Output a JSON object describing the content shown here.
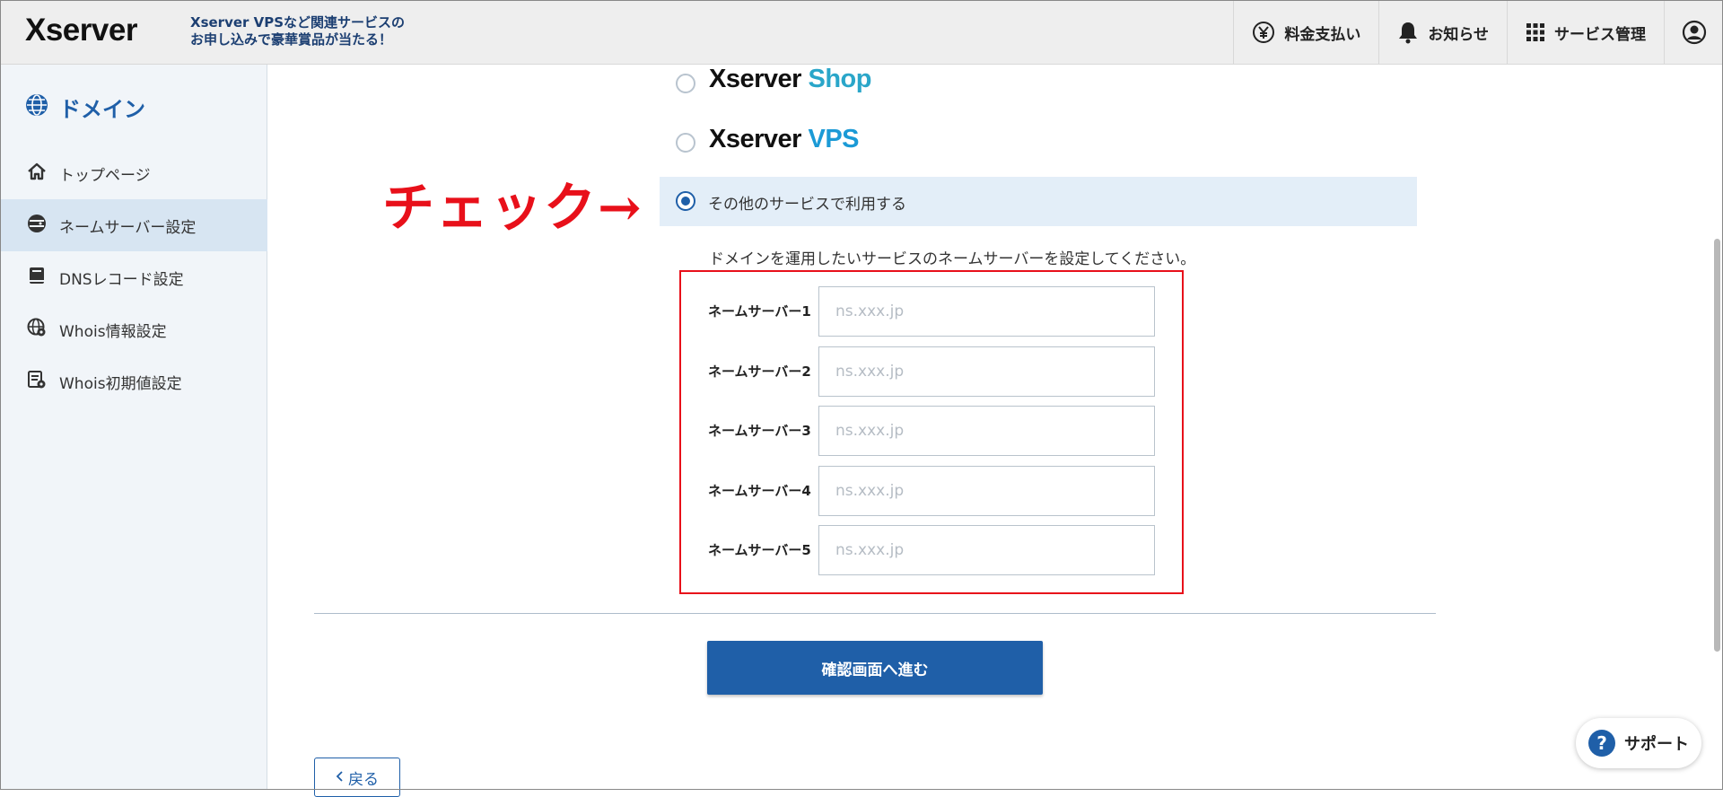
{
  "header": {
    "logo": "Xserver",
    "promo_line1": "Xserver VPSなど関連サービスの",
    "promo_line2": "お申し込みで豪華賞品が当たる！",
    "nav": {
      "payment": "料金支払い",
      "notice": "お知らせ",
      "service": "サービス管理"
    }
  },
  "sidebar": {
    "title": "ドメイン",
    "items": [
      {
        "label": "トップページ",
        "icon": "home-icon"
      },
      {
        "label": "ネームサーバー設定",
        "icon": "server-icon"
      },
      {
        "label": "DNSレコード設定",
        "icon": "book-icon"
      },
      {
        "label": "Whois情報設定",
        "icon": "globe-gear-icon"
      },
      {
        "label": "Whois初期値設定",
        "icon": "document-gear-icon"
      }
    ]
  },
  "main": {
    "options": {
      "shop": {
        "prefix": "Xserver",
        "suffix": "Shop"
      },
      "vps": {
        "prefix": "Xserver",
        "suffix": "VPS"
      },
      "other": "その他のサービスで利用する"
    },
    "annotation": "チェック→",
    "description": "ドメインを運用したいサービスのネームサーバーを設定してください。",
    "nameservers": [
      {
        "label": "ネームサーバー1",
        "placeholder": "ns.xxx.jp",
        "value": ""
      },
      {
        "label": "ネームサーバー2",
        "placeholder": "ns.xxx.jp",
        "value": ""
      },
      {
        "label": "ネームサーバー3",
        "placeholder": "ns.xxx.jp",
        "value": ""
      },
      {
        "label": "ネームサーバー4",
        "placeholder": "ns.xxx.jp",
        "value": ""
      },
      {
        "label": "ネームサーバー5",
        "placeholder": "ns.xxx.jp",
        "value": ""
      }
    ],
    "confirm_label": "確認画面へ進む",
    "back_label": "戻る"
  },
  "support_label": "サポート",
  "colors": {
    "accent": "#1f5fa8",
    "annotation": "#e8101a",
    "shop": "#2aa6c9",
    "vps": "#1b9ad6"
  }
}
